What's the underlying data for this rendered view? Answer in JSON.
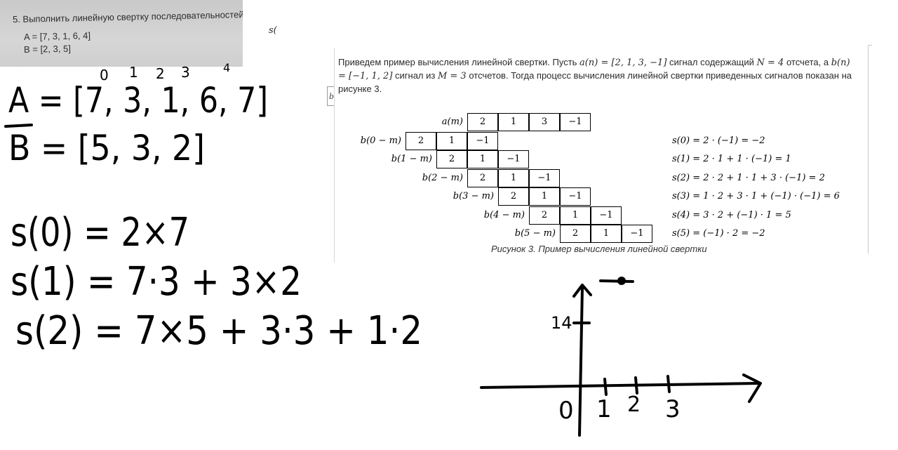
{
  "photo": {
    "task_line": "5. Выполнить линейную свертку последовательностей:",
    "a_line": "A = [7, 3, 1, 6, 4]",
    "b_line": "B = [2, 3, 5]"
  },
  "fragment_s": "s(",
  "fragment_box": "b",
  "document": {
    "paragraph": {
      "t1": "Приведем пример вычисления линейной свертки. Пусть ",
      "m1": "a(n) = [2, 1, 3, −1]",
      "t2": " сигнал содержащий ",
      "m2": "N = 4",
      "t3": " отсчета, а ",
      "m3": "b(n) = [−1, 1, 2]",
      "t4": " сигнал из ",
      "m4": "M = 3",
      "t5": " отсчетов. Тогда процесс вычисления линейной свертки приведенных сигналов показан на рисунке 3."
    },
    "table": {
      "a_label": "a(m)",
      "a_values": [
        "2",
        "1",
        "3",
        "−1"
      ],
      "rows": [
        {
          "label": "b(0 − m)",
          "values": [
            "2",
            "1",
            "−1"
          ],
          "formula": "s(0) = 2 · (−1) = −2"
        },
        {
          "label": "b(1 − m)",
          "values": [
            "2",
            "1",
            "−1"
          ],
          "formula": "s(1) = 2 · 1 + 1 · (−1) = 1"
        },
        {
          "label": "b(2 − m)",
          "values": [
            "2",
            "1",
            "−1"
          ],
          "formula": "s(2) = 2 · 2 + 1 · 1 + 3 · (−1) = 2"
        },
        {
          "label": "b(3 − m)",
          "values": [
            "2",
            "1",
            "−1"
          ],
          "formula": "s(3) = 1 · 2 + 3 · 1 + (−1) · (−1) = 6"
        },
        {
          "label": "b(4 − m)",
          "values": [
            "2",
            "1",
            "−1"
          ],
          "formula": "s(4) = 3 · 2 + (−1) · 1 = 5"
        },
        {
          "label": "b(5 − m)",
          "values": [
            "2",
            "1",
            "−1"
          ],
          "formula": "s(5) = (−1) · 2 = −2"
        }
      ]
    },
    "caption": "Рисунок 3. Пример вычисления линейной свертки"
  },
  "handwriting": {
    "indices": [
      "0",
      "1",
      "2",
      "3",
      "4"
    ],
    "line_a": "A = [7, 3, 1, 6, 7]",
    "line_b": "B = [5, 3, 2]",
    "s0": "s(0) = 2×7",
    "s1": "s(1) = 7·3 + 3×2",
    "s2": "s(2) = 7×5 + 3·3 + 1·2",
    "graph_y_label": "14",
    "graph_x_labels": [
      "0",
      "1",
      "2",
      "3"
    ]
  },
  "colors": {
    "ink": "#000000",
    "photo_background": "#cfcfcf"
  }
}
